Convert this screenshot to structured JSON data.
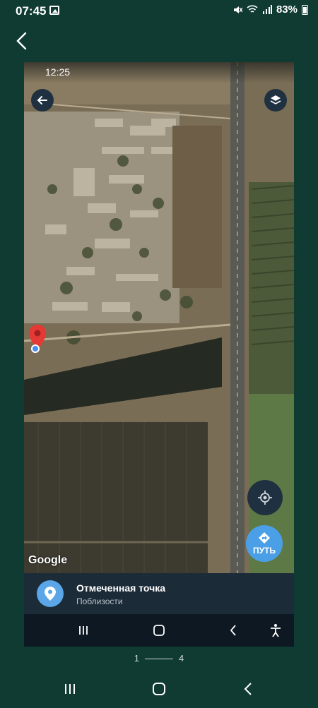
{
  "status_bar": {
    "time": "07:45",
    "battery": "83%"
  },
  "inner_status": {
    "time": "12:25"
  },
  "map": {
    "watermark": "Google",
    "route_label": "ПУТЬ"
  },
  "place": {
    "title": "Отмеченная точка",
    "subtitle": "Поблизости"
  },
  "pager": {
    "current": "1",
    "total": "4"
  },
  "colors": {
    "bg": "#0f3b33",
    "accent": "#4a9fe6",
    "pin": "#e53935"
  },
  "icons": [
    "gallery-icon",
    "mute-icon",
    "wifi-icon",
    "signal-icon",
    "battery-icon",
    "back-icon",
    "layers-icon",
    "my-location-icon",
    "directions-icon",
    "map-pin-icon",
    "recents-icon",
    "home-icon",
    "accessibility-icon"
  ]
}
